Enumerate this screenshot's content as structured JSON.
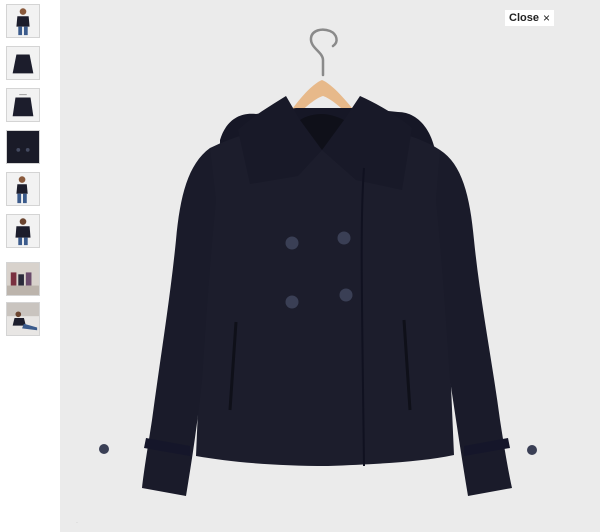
{
  "viewer": {
    "close_label": "Close",
    "close_icon": "×"
  },
  "thumbnails": [
    {
      "name": "thumb-model-front",
      "kind": "model"
    },
    {
      "name": "thumb-coat-front",
      "kind": "coat"
    },
    {
      "name": "thumb-coat-hanger",
      "kind": "coat"
    },
    {
      "name": "thumb-fabric-detail",
      "kind": "detail"
    },
    {
      "name": "thumb-model-open",
      "kind": "model"
    },
    {
      "name": "thumb-model-back",
      "kind": "model"
    },
    {
      "name": "thumb-group-photo",
      "kind": "group"
    },
    {
      "name": "thumb-model-sitting",
      "kind": "sitting"
    }
  ],
  "colors": {
    "coat": "#1c1d2c",
    "coat_shadow": "#121320",
    "button": "#3a3f55",
    "hanger": "#e7b98a",
    "background": "#ebebeb"
  }
}
